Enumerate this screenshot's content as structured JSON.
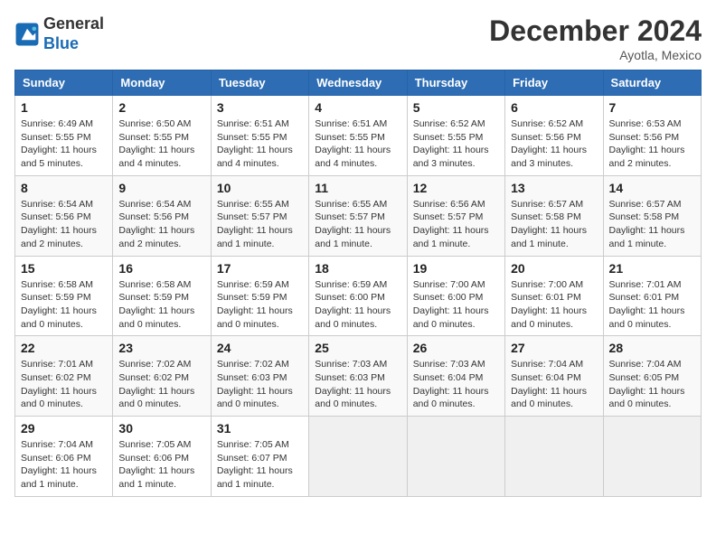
{
  "logo": {
    "line1": "General",
    "line2": "Blue"
  },
  "title": "December 2024",
  "subtitle": "Ayotla, Mexico",
  "weekdays": [
    "Sunday",
    "Monday",
    "Tuesday",
    "Wednesday",
    "Thursday",
    "Friday",
    "Saturday"
  ],
  "weeks": [
    [
      {
        "day": 1,
        "sunrise": "6:49 AM",
        "sunset": "5:55 PM",
        "daylight": "11 hours and 5 minutes."
      },
      {
        "day": 2,
        "sunrise": "6:50 AM",
        "sunset": "5:55 PM",
        "daylight": "11 hours and 4 minutes."
      },
      {
        "day": 3,
        "sunrise": "6:51 AM",
        "sunset": "5:55 PM",
        "daylight": "11 hours and 4 minutes."
      },
      {
        "day": 4,
        "sunrise": "6:51 AM",
        "sunset": "5:55 PM",
        "daylight": "11 hours and 4 minutes."
      },
      {
        "day": 5,
        "sunrise": "6:52 AM",
        "sunset": "5:55 PM",
        "daylight": "11 hours and 3 minutes."
      },
      {
        "day": 6,
        "sunrise": "6:52 AM",
        "sunset": "5:56 PM",
        "daylight": "11 hours and 3 minutes."
      },
      {
        "day": 7,
        "sunrise": "6:53 AM",
        "sunset": "5:56 PM",
        "daylight": "11 hours and 2 minutes."
      }
    ],
    [
      {
        "day": 8,
        "sunrise": "6:54 AM",
        "sunset": "5:56 PM",
        "daylight": "11 hours and 2 minutes."
      },
      {
        "day": 9,
        "sunrise": "6:54 AM",
        "sunset": "5:56 PM",
        "daylight": "11 hours and 2 minutes."
      },
      {
        "day": 10,
        "sunrise": "6:55 AM",
        "sunset": "5:57 PM",
        "daylight": "11 hours and 1 minute."
      },
      {
        "day": 11,
        "sunrise": "6:55 AM",
        "sunset": "5:57 PM",
        "daylight": "11 hours and 1 minute."
      },
      {
        "day": 12,
        "sunrise": "6:56 AM",
        "sunset": "5:57 PM",
        "daylight": "11 hours and 1 minute."
      },
      {
        "day": 13,
        "sunrise": "6:57 AM",
        "sunset": "5:58 PM",
        "daylight": "11 hours and 1 minute."
      },
      {
        "day": 14,
        "sunrise": "6:57 AM",
        "sunset": "5:58 PM",
        "daylight": "11 hours and 1 minute."
      }
    ],
    [
      {
        "day": 15,
        "sunrise": "6:58 AM",
        "sunset": "5:59 PM",
        "daylight": "11 hours and 0 minutes."
      },
      {
        "day": 16,
        "sunrise": "6:58 AM",
        "sunset": "5:59 PM",
        "daylight": "11 hours and 0 minutes."
      },
      {
        "day": 17,
        "sunrise": "6:59 AM",
        "sunset": "5:59 PM",
        "daylight": "11 hours and 0 minutes."
      },
      {
        "day": 18,
        "sunrise": "6:59 AM",
        "sunset": "6:00 PM",
        "daylight": "11 hours and 0 minutes."
      },
      {
        "day": 19,
        "sunrise": "7:00 AM",
        "sunset": "6:00 PM",
        "daylight": "11 hours and 0 minutes."
      },
      {
        "day": 20,
        "sunrise": "7:00 AM",
        "sunset": "6:01 PM",
        "daylight": "11 hours and 0 minutes."
      },
      {
        "day": 21,
        "sunrise": "7:01 AM",
        "sunset": "6:01 PM",
        "daylight": "11 hours and 0 minutes."
      }
    ],
    [
      {
        "day": 22,
        "sunrise": "7:01 AM",
        "sunset": "6:02 PM",
        "daylight": "11 hours and 0 minutes."
      },
      {
        "day": 23,
        "sunrise": "7:02 AM",
        "sunset": "6:02 PM",
        "daylight": "11 hours and 0 minutes."
      },
      {
        "day": 24,
        "sunrise": "7:02 AM",
        "sunset": "6:03 PM",
        "daylight": "11 hours and 0 minutes."
      },
      {
        "day": 25,
        "sunrise": "7:03 AM",
        "sunset": "6:03 PM",
        "daylight": "11 hours and 0 minutes."
      },
      {
        "day": 26,
        "sunrise": "7:03 AM",
        "sunset": "6:04 PM",
        "daylight": "11 hours and 0 minutes."
      },
      {
        "day": 27,
        "sunrise": "7:04 AM",
        "sunset": "6:04 PM",
        "daylight": "11 hours and 0 minutes."
      },
      {
        "day": 28,
        "sunrise": "7:04 AM",
        "sunset": "6:05 PM",
        "daylight": "11 hours and 0 minutes."
      }
    ],
    [
      {
        "day": 29,
        "sunrise": "7:04 AM",
        "sunset": "6:06 PM",
        "daylight": "11 hours and 1 minute."
      },
      {
        "day": 30,
        "sunrise": "7:05 AM",
        "sunset": "6:06 PM",
        "daylight": "11 hours and 1 minute."
      },
      {
        "day": 31,
        "sunrise": "7:05 AM",
        "sunset": "6:07 PM",
        "daylight": "11 hours and 1 minute."
      },
      null,
      null,
      null,
      null
    ]
  ],
  "labels": {
    "sunrise": "Sunrise:",
    "sunset": "Sunset:",
    "daylight": "Daylight:"
  }
}
